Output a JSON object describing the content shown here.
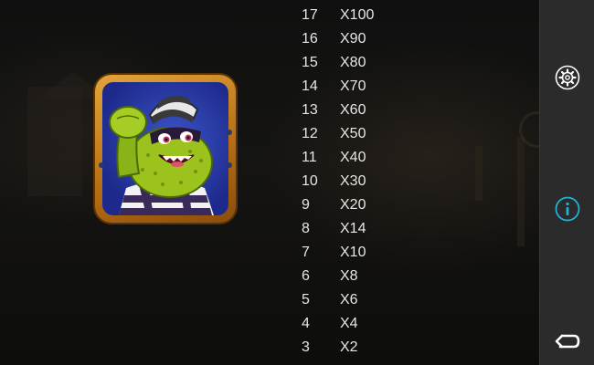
{
  "symbol": {
    "name": "green-monster-robber-symbol"
  },
  "paytable": [
    {
      "count": "17",
      "multiplier": "X100"
    },
    {
      "count": "16",
      "multiplier": "X90"
    },
    {
      "count": "15",
      "multiplier": "X80"
    },
    {
      "count": "14",
      "multiplier": "X70"
    },
    {
      "count": "13",
      "multiplier": "X60"
    },
    {
      "count": "12",
      "multiplier": "X50"
    },
    {
      "count": "11",
      "multiplier": "X40"
    },
    {
      "count": "10",
      "multiplier": "X30"
    },
    {
      "count": "9",
      "multiplier": "X20"
    },
    {
      "count": "8",
      "multiplier": "X14"
    },
    {
      "count": "7",
      "multiplier": "X10"
    },
    {
      "count": "6",
      "multiplier": "X8"
    },
    {
      "count": "5",
      "multiplier": "X6"
    },
    {
      "count": "4",
      "multiplier": "X4"
    },
    {
      "count": "3",
      "multiplier": "X2"
    }
  ],
  "side_panel": {
    "buttons": [
      {
        "icon": "gear-icon",
        "color": "#ffffff"
      },
      {
        "icon": "info-icon",
        "color": "#1fb3d8"
      },
      {
        "icon": "return-arrow-icon",
        "color": "#ffffff"
      }
    ]
  },
  "colors": {
    "text": "#e6e6e6",
    "panel": "#2b2b2b",
    "frame_gold": "#d08a22",
    "tile_blue": "#2a3ea8",
    "monster_green": "#9cc21e",
    "info_accent": "#1fb3d8"
  }
}
